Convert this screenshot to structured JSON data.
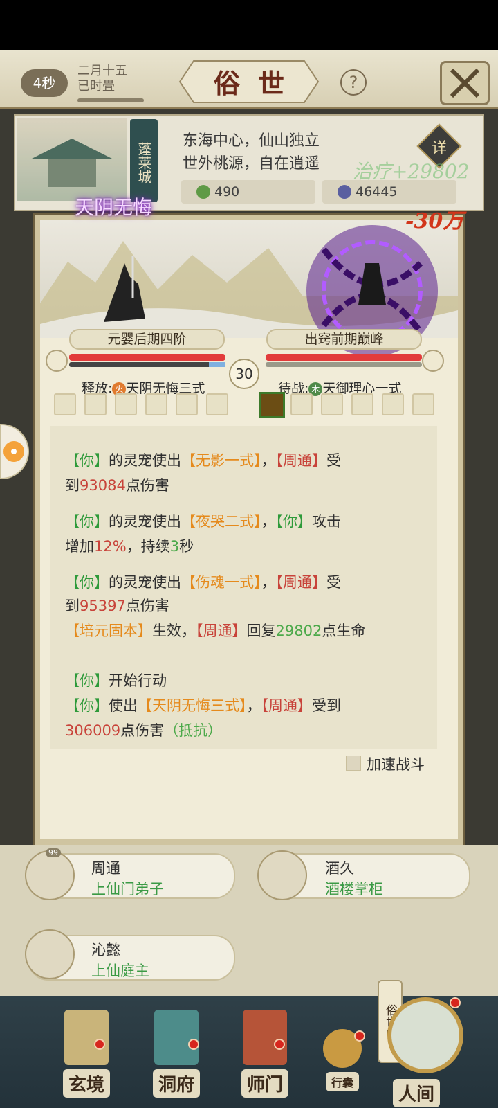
{
  "header": {
    "timer": "4秒",
    "date_line1": "二月十五",
    "date_line2": "已时畳",
    "title": "俗世",
    "help": "?"
  },
  "location": {
    "city": "蓬莱城",
    "desc_line1": "东海中心，仙山独立",
    "desc_line2": "世外桃源，自在逍遥",
    "detail": "详",
    "resource1": "490",
    "resource2": "46445"
  },
  "floats": {
    "heal": "治疗+29802",
    "damage": "-30万"
  },
  "battle": {
    "skill_banner": "天阴无悔",
    "player_realm": "元婴后期四阶",
    "enemy_realm": "出窍前期巅峰",
    "round": "30",
    "release_label": "释放:",
    "release_elem": "火",
    "release_skill": "天阴无悔三式",
    "standby_label": "待战:",
    "standby_elem": "木",
    "standby_skill": "天御理心一式",
    "player_hp": 1.0,
    "enemy_hp": 1.0
  },
  "log": {
    "l1": [
      "【你】",
      "的灵宠使出",
      "【无影一式】",
      "，",
      "【周通】",
      "受"
    ],
    "l1b": [
      "到",
      "93084",
      "点伤害"
    ],
    "l2": [
      "【你】",
      "的灵宠使出",
      "【夜哭二式】",
      "，",
      "【你】",
      "攻击"
    ],
    "l2b": [
      "增加",
      "12%",
      "，持续",
      "3",
      "秒"
    ],
    "l3": [
      "【你】",
      "的灵宠使出",
      "【伤魂一式】",
      "，",
      "【周通】",
      "受"
    ],
    "l3b": [
      "到",
      "95397",
      "点伤害"
    ],
    "l4": [
      "【培元固本】",
      "生效，",
      "【周通】",
      "回复",
      "29802",
      "点生命"
    ],
    "l5": [
      "【你】",
      "开始行动"
    ],
    "l6": [
      "【你】",
      "使出",
      "【天阴无悔三式】",
      "，",
      "【周通】",
      "受到"
    ],
    "l6b": [
      "306009",
      "点伤害",
      "（抵抗）"
    ]
  },
  "speed_label": "加速战斗",
  "npcs": [
    {
      "name": "周通",
      "role": "上仙门弟子",
      "badge": "99"
    },
    {
      "name": "酒久",
      "role": "酒楼掌柜"
    },
    {
      "name": "沁懿",
      "role": "上仙庭主"
    }
  ],
  "nav": [
    {
      "label": "玄境"
    },
    {
      "label": "洞府"
    },
    {
      "label": "师门"
    },
    {
      "label": "行囊"
    },
    {
      "label": "人间"
    }
  ],
  "nav_extra": {
    "world_tag": "俗世中"
  },
  "colors": {
    "ally": "#2e9a3a",
    "skill": "#e58a1c",
    "enemy": "#c8433a",
    "heal": "#4ca94a",
    "purple_glow": "#8e2bd6"
  }
}
